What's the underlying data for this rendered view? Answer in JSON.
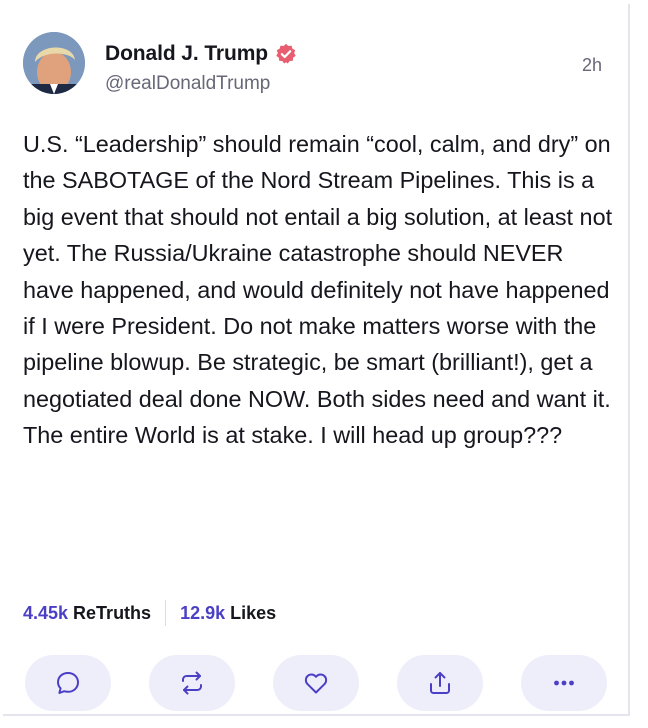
{
  "post": {
    "author_name": "Donald J. Trump",
    "handle": "@realDonaldTrump",
    "time": "2h",
    "text": "U.S. “Leadership” should remain “cool, calm, and dry” on the SABOTAGE of the Nord Stream Pipelines. This is a big event that should not entail a big solution, at least not yet. The Russia/Ukraine catastrophe should NEVER have happened, and would definitely not have happened if I were President. Do not make matters worse with the pipeline blowup. Be strategic, be smart (brilliant!), get a negotiated deal done NOW. Both sides need and want it. The entire World is at stake. I will head up group???"
  },
  "stats": {
    "retruths_count": "4.45k",
    "retruths_label": "ReTruths",
    "likes_count": "12.9k",
    "likes_label": "Likes"
  },
  "actions": [
    {
      "icon": "comment-icon"
    },
    {
      "icon": "retruth-icon"
    },
    {
      "icon": "heart-icon"
    },
    {
      "icon": "share-icon"
    },
    {
      "icon": "more-icon"
    }
  ],
  "colors": {
    "accent": "#4b3fc6",
    "verified_badge": "#e85d6f",
    "action_bg": "#eeeefa",
    "icon": "#4b3fc6",
    "secondary_text": "#676778"
  }
}
